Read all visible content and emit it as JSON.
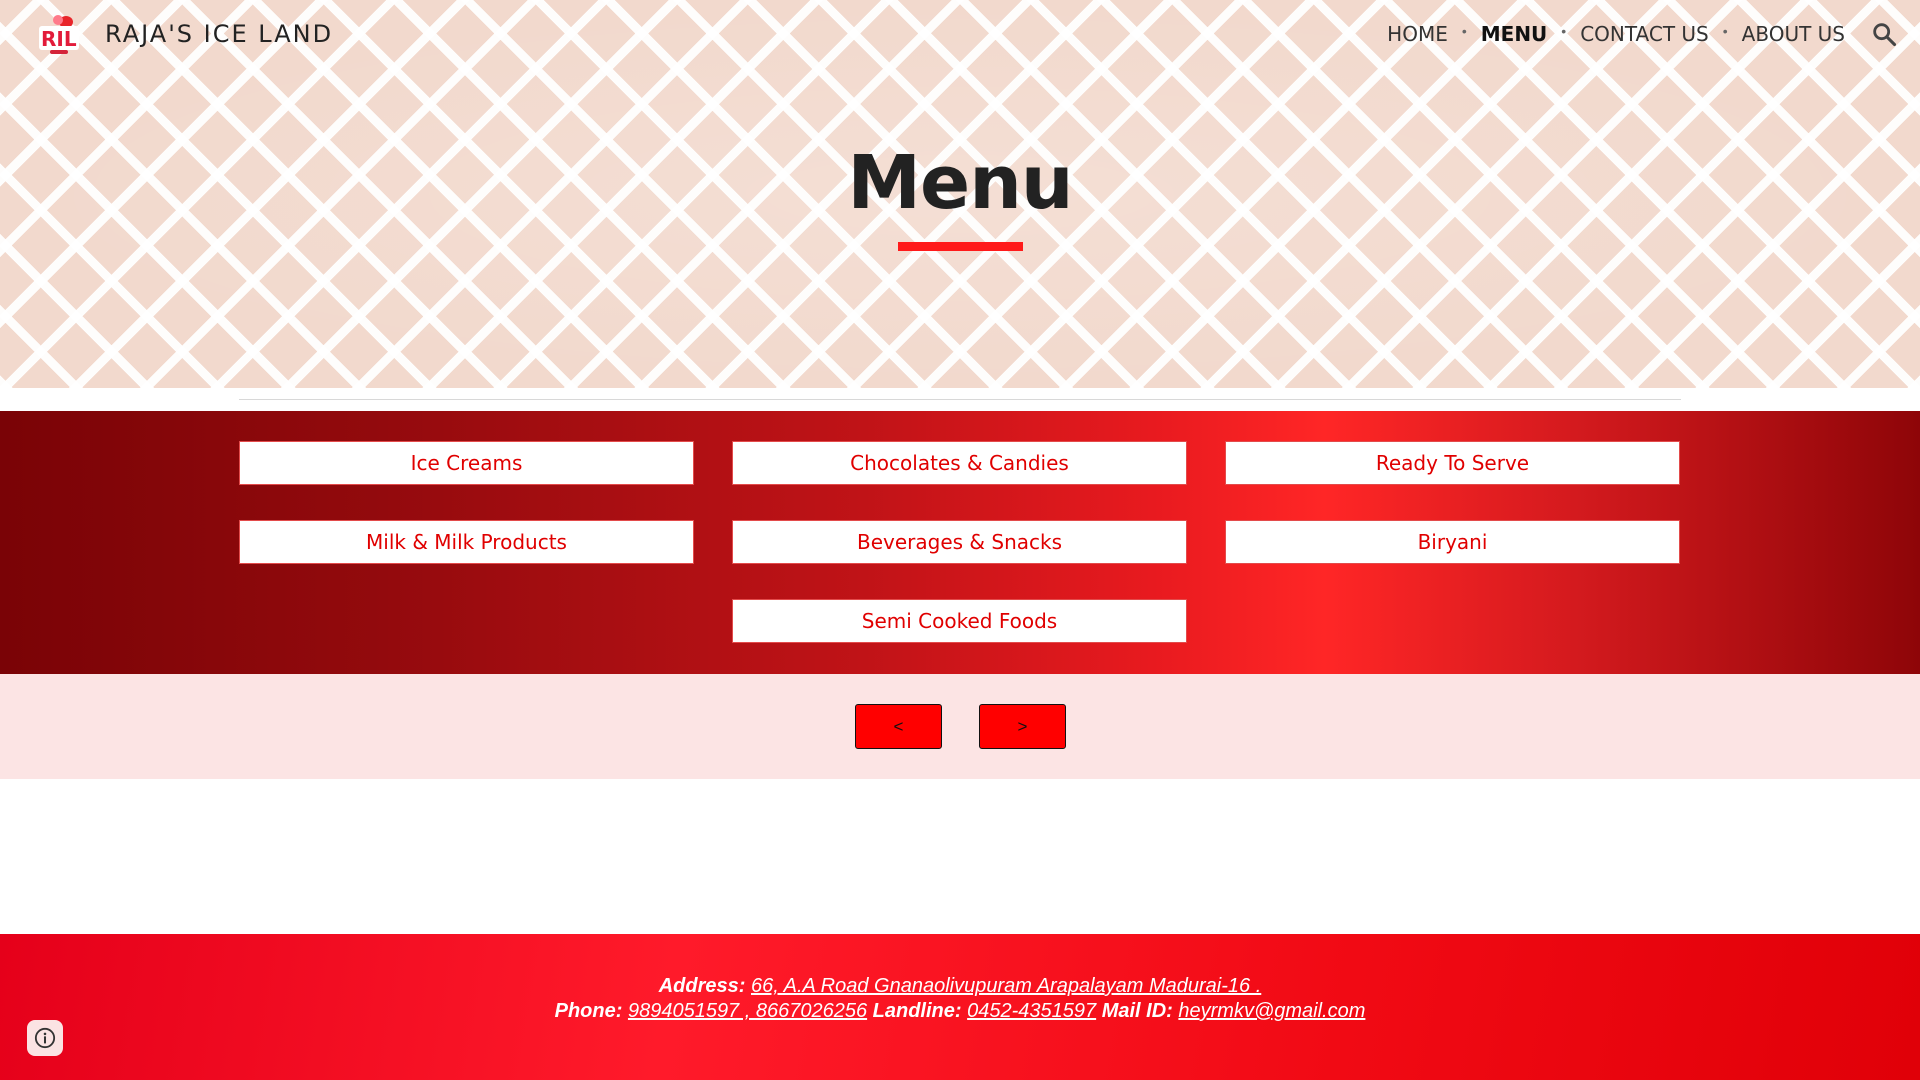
{
  "site": {
    "title": "RAJA'S ICE LAND",
    "logo_text": "RIL"
  },
  "nav": {
    "items": [
      "HOME",
      "MENU",
      "CONTACT US",
      "ABOUT US"
    ],
    "active": "MENU"
  },
  "hero": {
    "title": "Menu"
  },
  "categories": [
    "Ice Creams",
    "Chocolates & Candies",
    "Ready To Serve",
    "Milk & Milk Products",
    "Beverages & Snacks",
    "Biryani",
    "Semi Cooked Foods"
  ],
  "pager": {
    "prev": "<",
    "next": ">"
  },
  "footer": {
    "address_label": "Address:",
    "address_value": "66, A.A Road Gnanaolivupuram Arapalayam Madurai-16 .",
    "phone_label": "Phone:",
    "phone_value": "9894051597 , 8667026256",
    "landline_label": "Landline:",
    "landline_value": "0452-4351597",
    "mail_label": "Mail ID:",
    "mail_value": "heyrmkv@gmail.com"
  },
  "colors": {
    "accent": "#ff1a1a",
    "band_dark": "#7a0306",
    "band_bright": "#ff2626",
    "pager_bg": "#fce4e4",
    "footer_red": "#ff1a2a",
    "category_text": "#e00000"
  },
  "icons": {
    "search": "search-icon",
    "info": "info-icon",
    "logo": "ril-logo"
  }
}
